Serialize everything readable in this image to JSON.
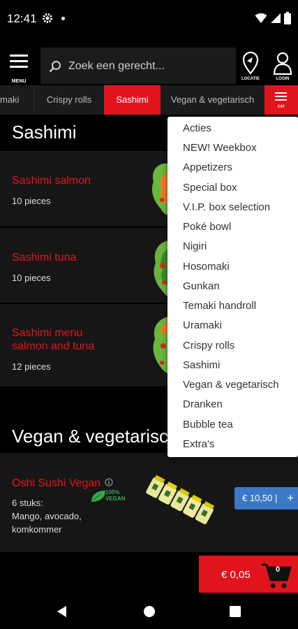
{
  "status_bar": {
    "time": "12:41"
  },
  "header": {
    "menu_label": "MENU",
    "search_placeholder": "Zoek een gerecht...",
    "location_label": "LOCATIE",
    "login_label": "LOGIN"
  },
  "tabs": [
    {
      "label": "maki"
    },
    {
      "label": "Crispy rolls"
    },
    {
      "label": "Sashimi",
      "active": true
    },
    {
      "label": "Vegan & vegetarisch"
    }
  ],
  "cat_label": "CAT",
  "sections": {
    "sashimi": {
      "title": "Sashimi",
      "items": [
        {
          "name": "Sashimi salmon",
          "detail": "10 pieces"
        },
        {
          "name": "Sashimi tuna",
          "detail": "10 pieces"
        },
        {
          "name_line1": "Sashimi menu",
          "name_line2": "salmon and tuna",
          "detail": "12 pieces"
        }
      ]
    },
    "vegan": {
      "title": "Vegan & vegetarisch",
      "items": [
        {
          "name": "Oshi Sushi Vegan",
          "detail_line1": "6 stuks:",
          "detail_line2": "Mango, avocado,",
          "detail_line3": "komkommer",
          "badge_text": "100% VEGAN",
          "price": "€ 10,50 |",
          "add": "+"
        }
      ]
    }
  },
  "dropdown": {
    "items": [
      "Acties",
      "NEW! Weekbox",
      "Appetizers",
      "Special box",
      "V.I.P. box selection",
      "Poké bowl",
      "Nigiri",
      "Hosomaki",
      "Gunkan",
      "Temaki handroll",
      "Uramaki",
      "Crispy rolls",
      "Sashimi",
      "Vegan & vegetarisch",
      "Dranken",
      "Bubble tea",
      "Extra's"
    ]
  },
  "cart": {
    "total": "€ 0,05",
    "count": "0"
  },
  "colors": {
    "accent": "#e1141e",
    "price_button": "#3b79c8",
    "card": "#161616",
    "tabs_bg": "#1b1b1b"
  }
}
